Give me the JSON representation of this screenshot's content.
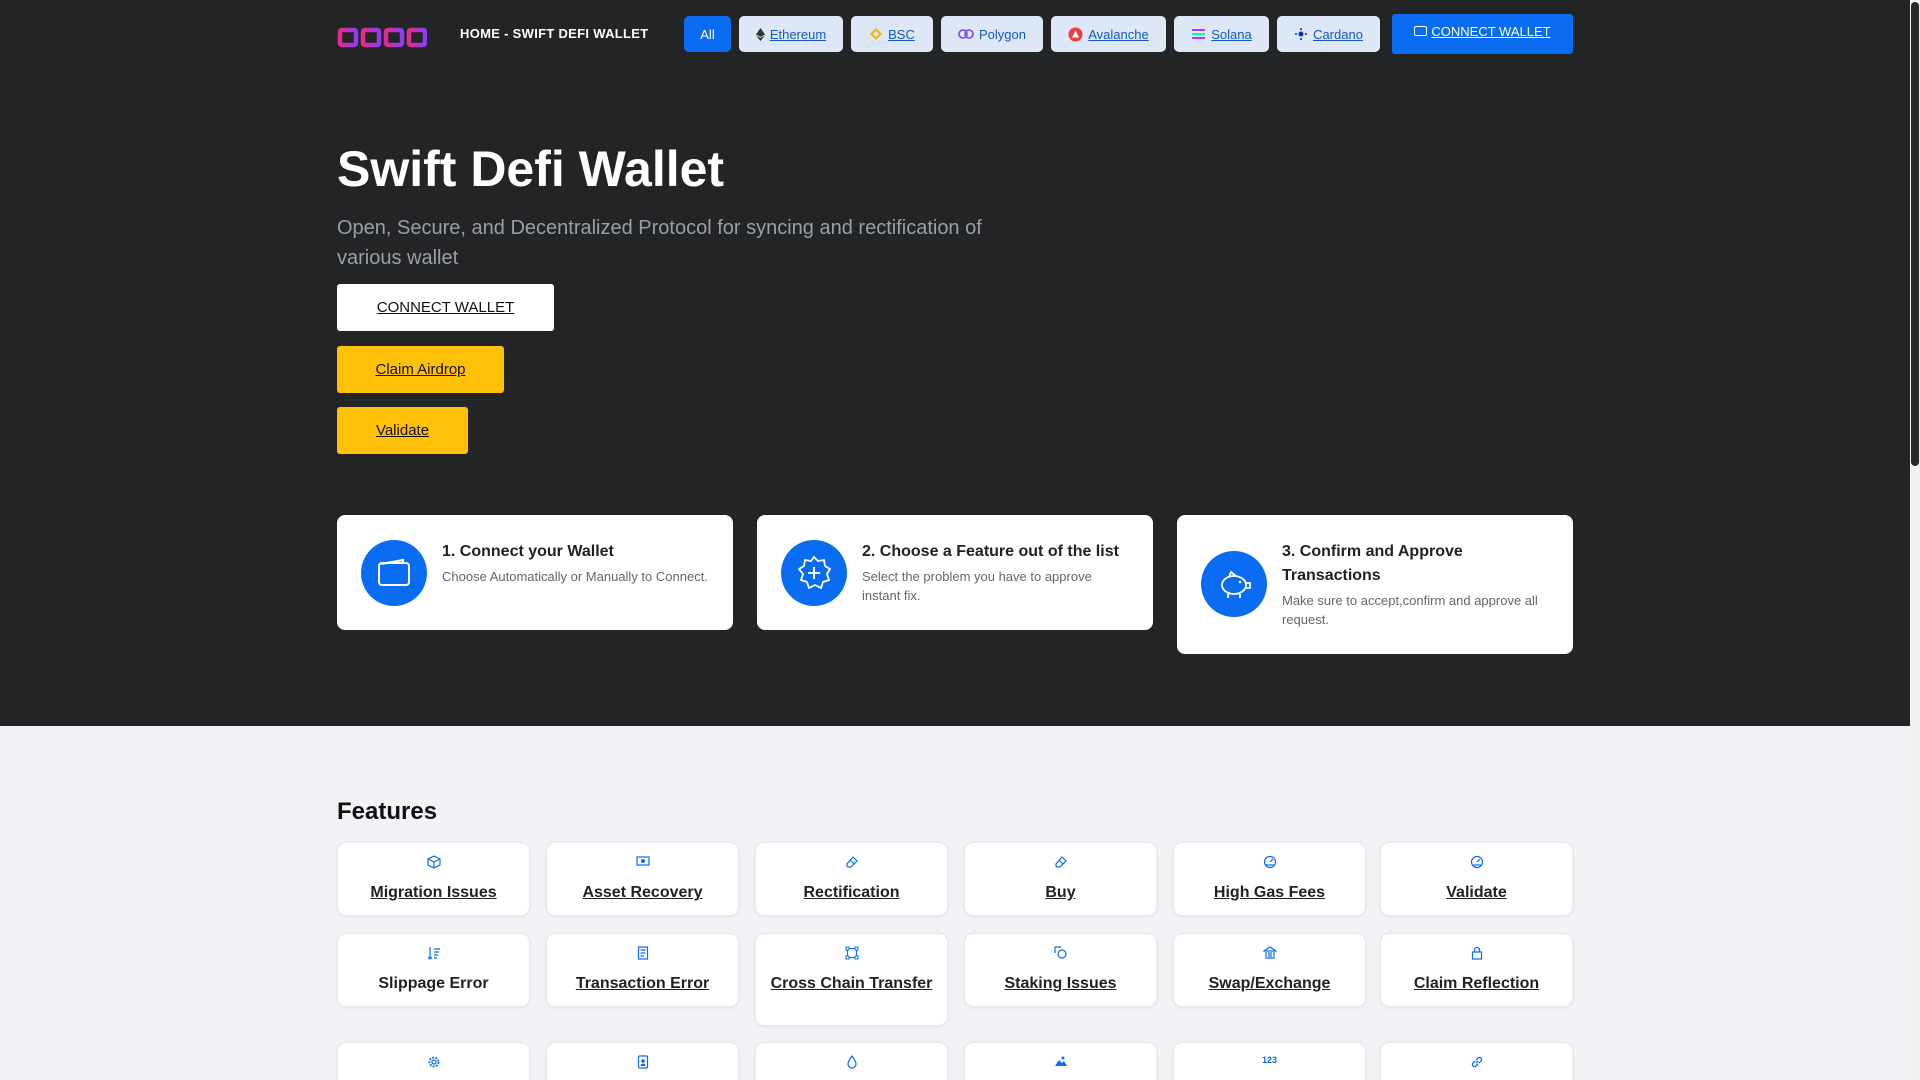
{
  "nav": {
    "brand": "HOME - SWIFT DEFI WALLET",
    "chips": [
      {
        "label": "All"
      },
      {
        "label": " Ethereum",
        "icon": "ethereum-icon"
      },
      {
        "label": " BSC",
        "icon": "bsc-icon"
      },
      {
        "label": "Polygon",
        "icon": "polygon-icon"
      },
      {
        "label": " Avalanche",
        "icon": "avalanche-icon"
      },
      {
        "label": " Solana",
        "icon": "solana-icon"
      },
      {
        "label": " Cardano",
        "icon": "cardano-icon"
      }
    ],
    "connect_label": "CONNECT WALLET"
  },
  "hero": {
    "title": "Swift Defi Wallet",
    "subtitle": "Open, Secure, and Decentralized Protocol for syncing and rectification of various wallet",
    "connect_label": "CONNECT WALLET",
    "airdrop_label": "Claim Airdrop",
    "validate_label": "Validate"
  },
  "steps": [
    {
      "title": "1. Connect your Wallet",
      "desc": "Choose Automatically or Manually to Connect.",
      "icon": "wallet-icon"
    },
    {
      "title": "2. Choose a Feature out of the list",
      "desc": "Select the problem you have to approve instant fix.",
      "icon": "plus-badge-icon"
    },
    {
      "title": "3. Confirm and Approve Transactions",
      "desc": "Make sure to accept,confirm and approve all request.",
      "icon": "piggy-bank-icon"
    }
  ],
  "features": {
    "title": "Features",
    "items": [
      {
        "label": "Migration Issues",
        "icon": "box-icon"
      },
      {
        "label": "Asset Recovery",
        "icon": "cash-icon"
      },
      {
        "label": "Rectification",
        "icon": "eraser-icon"
      },
      {
        "label": "Buy",
        "icon": "eraser-icon"
      },
      {
        "label": "High Gas Fees",
        "icon": "speedometer-icon"
      },
      {
        "label": "Validate",
        "icon": "speedometer-icon"
      },
      {
        "label": "Slippage Error",
        "icon": "sort-icon"
      },
      {
        "label": "Transaction Error",
        "icon": "receipt-icon"
      },
      {
        "label": "Cross Chain Transfer",
        "icon": "bounding-box-icon"
      },
      {
        "label": "Staking Issues",
        "icon": "coin-search-icon"
      },
      {
        "label": "Swap/Exchange",
        "icon": "bank-icon"
      },
      {
        "label": "Claim Reflection",
        "icon": "lock-icon"
      },
      {
        "label": "",
        "icon": "gear-icon"
      },
      {
        "label": "",
        "icon": "person-badge-icon"
      },
      {
        "label": "",
        "icon": "droplet-icon"
      },
      {
        "label": "",
        "icon": "image-icon"
      },
      {
        "label": "",
        "icon": "numbers-icon"
      },
      {
        "label": "",
        "icon": "link-icon"
      }
    ]
  },
  "numbers_icon_text": "123",
  "colors": {
    "primary": "#0a6cf0",
    "hero_bg": "#232425",
    "yellow": "#ffc107",
    "page_bg": "#f1f3f6"
  }
}
